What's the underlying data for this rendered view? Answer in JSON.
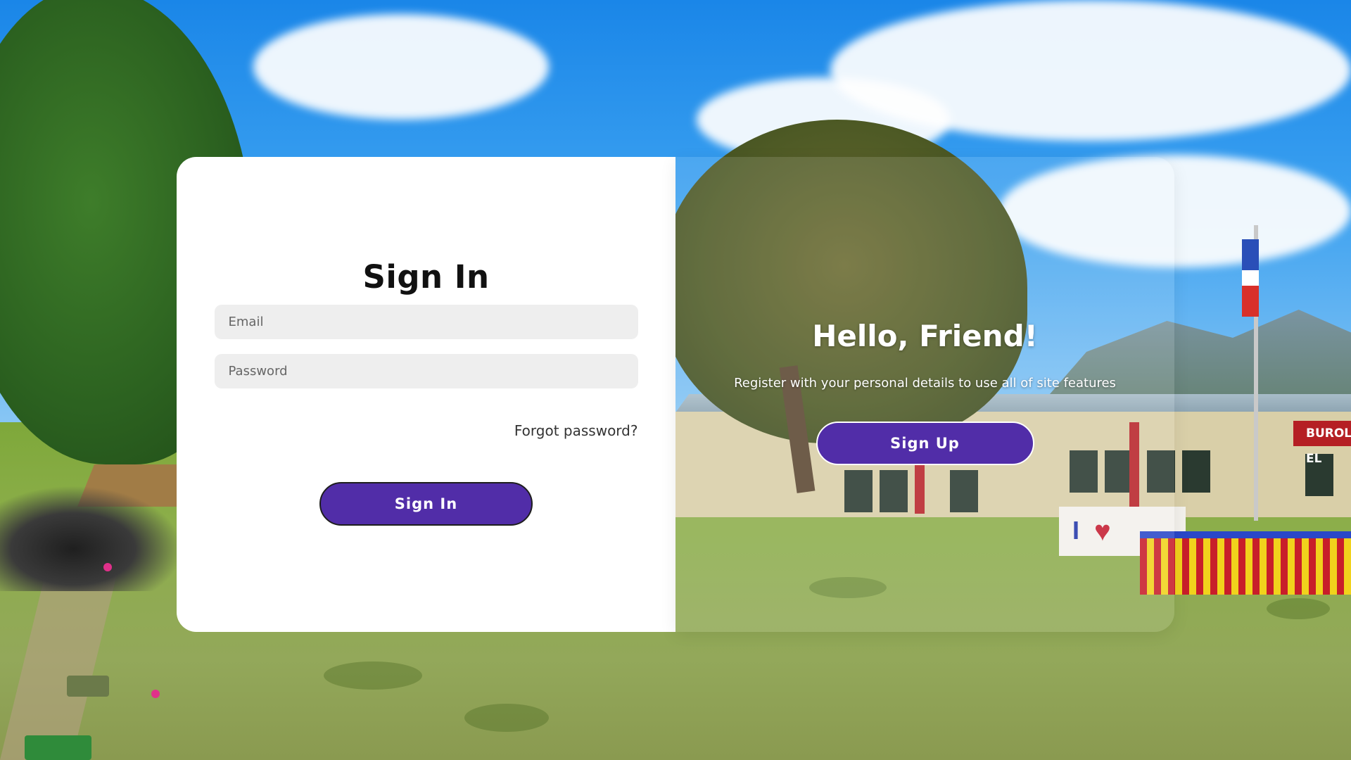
{
  "signin": {
    "title": "Sign In",
    "email_placeholder": "Email",
    "password_placeholder": "Password",
    "forgot_label": "Forgot password?",
    "button_label": "Sign In"
  },
  "signup": {
    "title": "Hello, Friend!",
    "subtitle": "Register with your personal details to use all of site features",
    "button_label": "Sign Up"
  },
  "background": {
    "sign_text": "BUROL EL",
    "wall_sign_letter": "I"
  },
  "colors": {
    "accent": "#512da8",
    "card_left": "#ffffff",
    "input_bg": "#eeeeee"
  },
  "icons": {
    "heart": "heart-icon"
  }
}
